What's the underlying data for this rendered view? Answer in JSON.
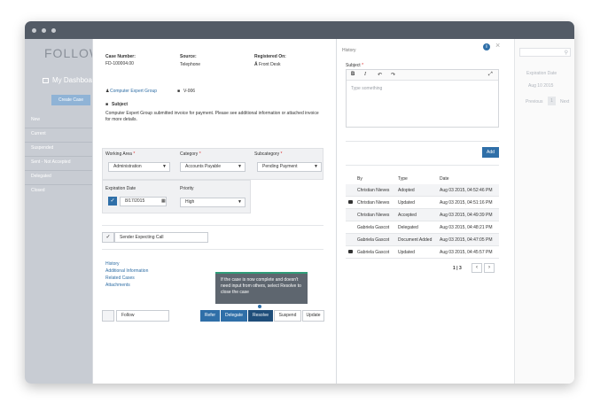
{
  "background": {
    "logo": "FOLLOW",
    "dashboard": "My Dashboa",
    "create_case": "Create Case",
    "nav": [
      "New",
      "Current",
      "Suspended",
      "Sent - Not Accepted",
      "Delegated",
      "Closed"
    ],
    "right_col_header": "Expiration Date",
    "right_col_value": "Aug 10 2015",
    "right_prev": "Previous",
    "right_page": "1",
    "right_next": "Next"
  },
  "case": {
    "number_label": "Case Number:",
    "number_value": "FD-100004.00",
    "source_label": "Source:",
    "source_value": "Telephone",
    "registered_label": "Registered On:",
    "registered_value": "Front Desk",
    "group_link": "Computer Expert Group",
    "ref_value": "V-006",
    "subject_label": "Subject",
    "description": "Computer Expert Group submitted invoice for payment. Please see additional information or attached invoice for more details.",
    "working_area_label": "Working Area",
    "working_area_value": "Administration",
    "category_label": "Category",
    "category_value": "Accounts Payable",
    "subcategory_label": "Subcategory",
    "subcategory_value": "Pending Payment",
    "expiration_label": "Expiration Date",
    "expiration_value": "8/17/2015",
    "priority_label": "Priority",
    "priority_value": "High",
    "sender_expecting": "Sender Expecting Call",
    "links": [
      "History",
      "Additional Information",
      "Related Cases",
      "Attachments"
    ],
    "follow_label": "Follow",
    "buttons": {
      "refer": "Refer",
      "delegate": "Delegate",
      "resolve": "Resolve",
      "suspend": "Suspend",
      "update": "Update"
    },
    "tooltip": "If the case is now complete and doesn't need input from others, select Resolve to close the case"
  },
  "history": {
    "title": "History",
    "subject_label": "Subject",
    "placeholder": "Type something",
    "add_button": "Add",
    "columns": [
      "By",
      "Type",
      "Date"
    ],
    "rows": [
      {
        "by": "Christian Nieves",
        "type": "Adopted",
        "date": "Aug 03 2015, 04:52:46 PM",
        "comment": false
      },
      {
        "by": "Christian Nieves",
        "type": "Updated",
        "date": "Aug 03 2015, 04:51:16 PM",
        "comment": true
      },
      {
        "by": "Christian Nieves",
        "type": "Accepted",
        "date": "Aug 03 2015, 04:49:39 PM",
        "comment": false
      },
      {
        "by": "Gabriela Gascot",
        "type": "Delegated",
        "date": "Aug 03 2015, 04:48:21 PM",
        "comment": false
      },
      {
        "by": "Gabriela Gascot",
        "type": "Document Added",
        "date": "Aug 03 2015, 04:47:05 PM",
        "comment": false
      },
      {
        "by": "Gabriela Gascot",
        "type": "Updated",
        "date": "Aug 03 2015, 04:45:57 PM",
        "comment": true
      }
    ],
    "pager": "1 | 3"
  },
  "colors": {
    "primary": "#2f6fa8",
    "titlebar": "#535b66",
    "tooltip": "#5e666f"
  }
}
